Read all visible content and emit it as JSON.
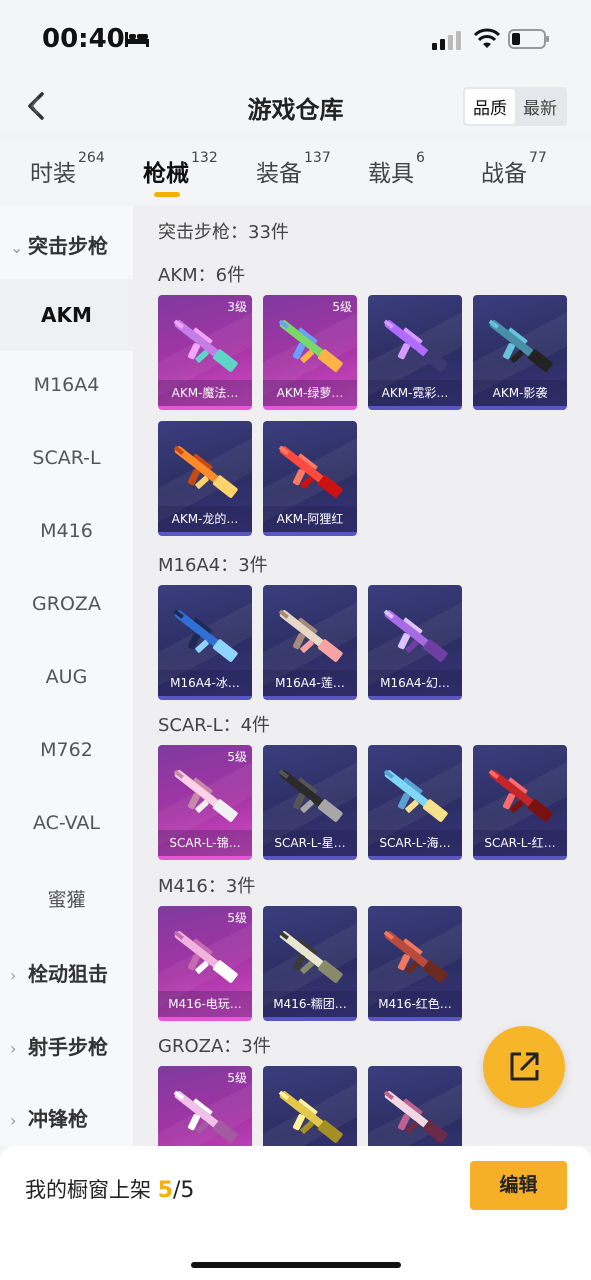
{
  "status_bar": {
    "time": "00:40"
  },
  "header": {
    "title": "游戏仓库",
    "sort_options": [
      "品质",
      "最新"
    ],
    "sort_selected": "品质"
  },
  "tabs": [
    {
      "label": "时装",
      "count": "264"
    },
    {
      "label": "枪械",
      "count": "132",
      "active": true
    },
    {
      "label": "装备",
      "count": "137"
    },
    {
      "label": "载具",
      "count": "6"
    },
    {
      "label": "战备",
      "count": "77"
    }
  ],
  "sidebar": {
    "category_open": "突击步枪",
    "items": [
      "AKM",
      "M16A4",
      "SCAR-L",
      "M416",
      "GROZA",
      "AUG",
      "M762",
      "AC-VAL",
      "蜜獾"
    ],
    "selected": "AKM",
    "categories_collapsed": [
      "栓动狙击",
      "射手步枪",
      "冲锋枪"
    ]
  },
  "content": {
    "summary": "突击步枪：33件",
    "groups": [
      {
        "label": "AKM：6件",
        "cards": [
          {
            "name": "AKM-魔法…",
            "level": "3级",
            "rarity": "gold"
          },
          {
            "name": "AKM-绿萝…",
            "level": "5级",
            "rarity": "gold"
          },
          {
            "name": "AKM-霓彩…",
            "level": "",
            "rarity": "purple"
          },
          {
            "name": "AKM-影袭",
            "level": "",
            "rarity": "purple"
          },
          {
            "name": "AKM-龙的…",
            "level": "",
            "rarity": "purple"
          },
          {
            "name": "AKM-阿狸红",
            "level": "",
            "rarity": "purple"
          }
        ]
      },
      {
        "label": "M16A4：3件",
        "cards": [
          {
            "name": "M16A4-冰…",
            "level": "",
            "rarity": "purple"
          },
          {
            "name": "M16A4-莲…",
            "level": "",
            "rarity": "purple"
          },
          {
            "name": "M16A4-幻…",
            "level": "",
            "rarity": "purple"
          }
        ]
      },
      {
        "label": "SCAR-L：4件",
        "cards": [
          {
            "name": "SCAR-L-锦…",
            "level": "5级",
            "rarity": "gold"
          },
          {
            "name": "SCAR-L-星…",
            "level": "",
            "rarity": "purple"
          },
          {
            "name": "SCAR-L-海…",
            "level": "",
            "rarity": "purple"
          },
          {
            "name": "SCAR-L-红…",
            "level": "",
            "rarity": "purple"
          }
        ]
      },
      {
        "label": "M416：3件",
        "cards": [
          {
            "name": "M416-电玩…",
            "level": "5级",
            "rarity": "gold"
          },
          {
            "name": "M416-糯团…",
            "level": "",
            "rarity": "purple"
          },
          {
            "name": "M416-红色…",
            "level": "",
            "rarity": "purple"
          }
        ]
      },
      {
        "label": "GROZA：3件",
        "cards": [
          {
            "name": "",
            "level": "5级",
            "rarity": "gold"
          },
          {
            "name": "",
            "level": "",
            "rarity": "purple"
          },
          {
            "name": "",
            "level": "",
            "rarity": "purple"
          }
        ]
      }
    ]
  },
  "bottom_bar": {
    "label": "我的橱窗上架",
    "count_current": "5",
    "count_total": "/5",
    "edit_label": "编辑"
  },
  "colors": {
    "accent": "#f5b000",
    "card_gold": "#a634a5",
    "card_purple": "#2c2d62"
  },
  "icons": [
    "back-arrow-icon",
    "share-icon",
    "signal-icon",
    "wifi-icon",
    "battery-icon",
    "bed-icon",
    "chevron-down-icon",
    "chevron-right-icon"
  ]
}
